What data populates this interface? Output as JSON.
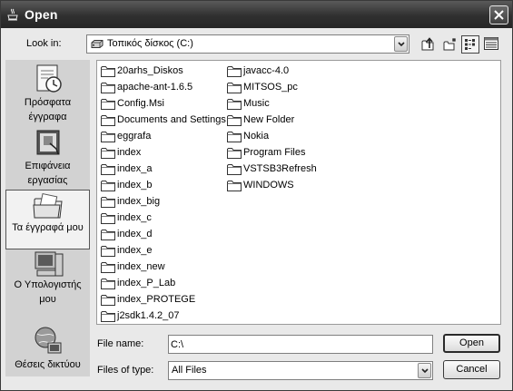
{
  "window": {
    "title": "Open"
  },
  "look_in": {
    "label": "Look in:",
    "value": "Τοπικός δίσκος (C:)"
  },
  "places": [
    {
      "label": "Πρόσφατα έγγραφα",
      "icon": "recent-documents-icon"
    },
    {
      "label": "Επιφάνεια εργασίας",
      "icon": "desktop-icon"
    },
    {
      "label": "Τα έγγραφά μου",
      "icon": "my-documents-icon"
    },
    {
      "label": "Ο Υπολογιστής μου",
      "icon": "my-computer-icon"
    },
    {
      "label": "Θέσεις δικτύου",
      "icon": "network-places-icon"
    }
  ],
  "files": {
    "column1": [
      "20arhs_Diskos",
      "apache-ant-1.6.5",
      "Config.Msi",
      "Documents and Settings",
      "eggrafa",
      "index",
      "index_a",
      "index_b",
      "index_big",
      "index_c",
      "index_d",
      "index_e",
      "index_new",
      "index_P_Lab",
      "index_PROTEGE",
      "j2sdk1.4.2_07"
    ],
    "column2": [
      "javacc-4.0",
      "MITSOS_pc",
      "Music",
      "New Folder",
      "Nokia",
      "Program Files",
      "VSTSB3Refresh",
      "WINDOWS"
    ]
  },
  "file_name": {
    "label": "File name:",
    "value": "C:\\"
  },
  "files_of_type": {
    "label": "Files of type:",
    "value": "All Files"
  },
  "buttons": {
    "open": "Open",
    "cancel": "Cancel"
  }
}
